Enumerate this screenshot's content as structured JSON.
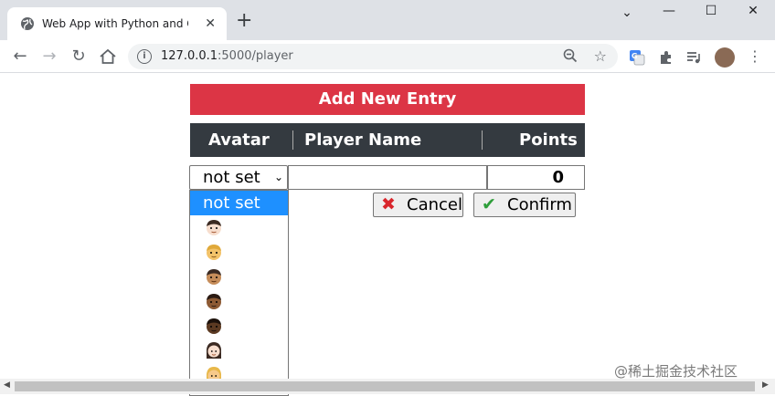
{
  "browser": {
    "tab_title": "Web App with Python and Cockroach",
    "url_host": "127.0.0.1",
    "url_path": ":5000/player",
    "new_tab_symbol": "+",
    "close_symbol": "✕",
    "win_min": "⌄",
    "win_minimize": "—",
    "win_max": "☐",
    "win_close": "✕"
  },
  "page": {
    "banner": "Add New Entry",
    "columns": [
      "Avatar",
      "Player Name",
      "Points"
    ],
    "form": {
      "avatar_selected": "not set",
      "player_name_value": "",
      "points_value": "0",
      "cancel_label": "Cancel",
      "confirm_label": "Confirm"
    },
    "dropdown": {
      "selected_label": "not set",
      "options": [
        "not set",
        "man-light",
        "man-blond",
        "man-medium",
        "man-medium-dark",
        "man-dark",
        "woman-light",
        "woman-blond"
      ]
    }
  },
  "watermark": "@稀土掘金技术社区",
  "colors": {
    "banner": "#dc3545",
    "table_header": "#343a40",
    "selected_option": "#1e90ff"
  }
}
